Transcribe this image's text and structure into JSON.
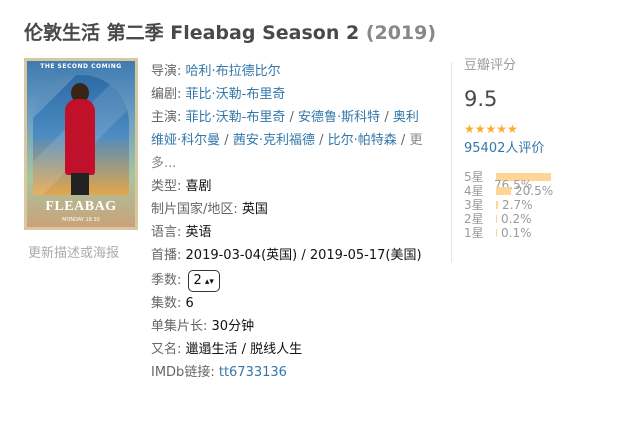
{
  "title": {
    "main": "伦敦生活 第二季 Fleabag Season 2",
    "year": "(2019)"
  },
  "poster": {
    "top_text": "THE SECOND COMING",
    "brand": "FLEABAG",
    "sub": "MONDAY 18.30"
  },
  "update_link": "更新描述或海报",
  "info": {
    "director_label": "导演:",
    "director": "哈利·布拉德比尔",
    "writer_label": "编剧:",
    "writer": "菲比·沃勒-布里奇",
    "cast_label": "主演:",
    "cast": [
      "菲比·沃勒-布里奇",
      "安德鲁·斯科特",
      "奥利维娅·科尔曼",
      "茜安·克利福德",
      "比尔·帕特森"
    ],
    "cast_more": "更多...",
    "genre_label": "类型:",
    "genre": "喜剧",
    "region_label": "制片国家/地区:",
    "region": "英国",
    "language_label": "语言:",
    "language": "英语",
    "premiere_label": "首播:",
    "premiere": "2019-03-04(英国) / 2019-05-17(美国)",
    "season_label": "季数:",
    "season": "2",
    "episodes_label": "集数:",
    "episodes": "6",
    "runtime_label": "单集片长:",
    "runtime": "30分钟",
    "aka_label": "又名:",
    "aka": "邋遢生活 / 脱线人生",
    "imdb_label": "IMDb链接:",
    "imdb": "tt6733136"
  },
  "rating": {
    "label": "豆瓣评分",
    "score": "9.5",
    "stars": "★★★★★",
    "count": "95402人评价",
    "bars": [
      {
        "star": "5星",
        "percent": "76.5%",
        "value": 76.5
      },
      {
        "star": "4星",
        "percent": "20.5%",
        "value": 20.5
      },
      {
        "star": "3星",
        "percent": "2.7%",
        "value": 2.7
      },
      {
        "star": "2星",
        "percent": "0.2%",
        "value": 0.2
      },
      {
        "star": "1星",
        "percent": "0.1%",
        "value": 0.1
      }
    ],
    "bar_color": "#ffd596",
    "star_color": "#ffac2d",
    "link_color": "#3377aa"
  }
}
